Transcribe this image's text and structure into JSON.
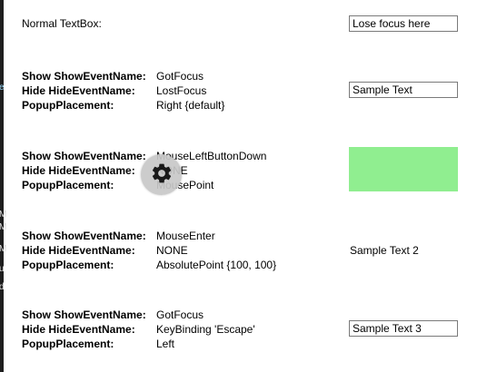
{
  "normal": {
    "label": "Normal TextBox:",
    "textbox_value": "Lose focus here"
  },
  "labels": {
    "show": "Show ShowEventName:",
    "hide": "Hide HideEventName:",
    "placement": "PopupPlacement:"
  },
  "examples": [
    {
      "show": "GotFocus",
      "hide": "LostFocus",
      "placement": "Right {default}",
      "target_text": "Sample Text"
    },
    {
      "show": "MouseLeftButtonDown",
      "hide": "NONE",
      "placement": "MousePoint",
      "target_color": "#90ee90"
    },
    {
      "show": "MouseEnter",
      "hide": "NONE",
      "placement": "AbsolutePoint {100, 100}",
      "target_text": "Sample Text 2"
    },
    {
      "show": "GotFocus",
      "hide": "KeyBinding 'Escape'",
      "placement": "Left",
      "target_text": "Sample Text 3"
    }
  ],
  "overlay": {
    "icon": "gear-icon"
  },
  "left_strip": {
    "glyphs": [
      "e",
      "M",
      "M",
      "M",
      "u",
      "d"
    ]
  }
}
